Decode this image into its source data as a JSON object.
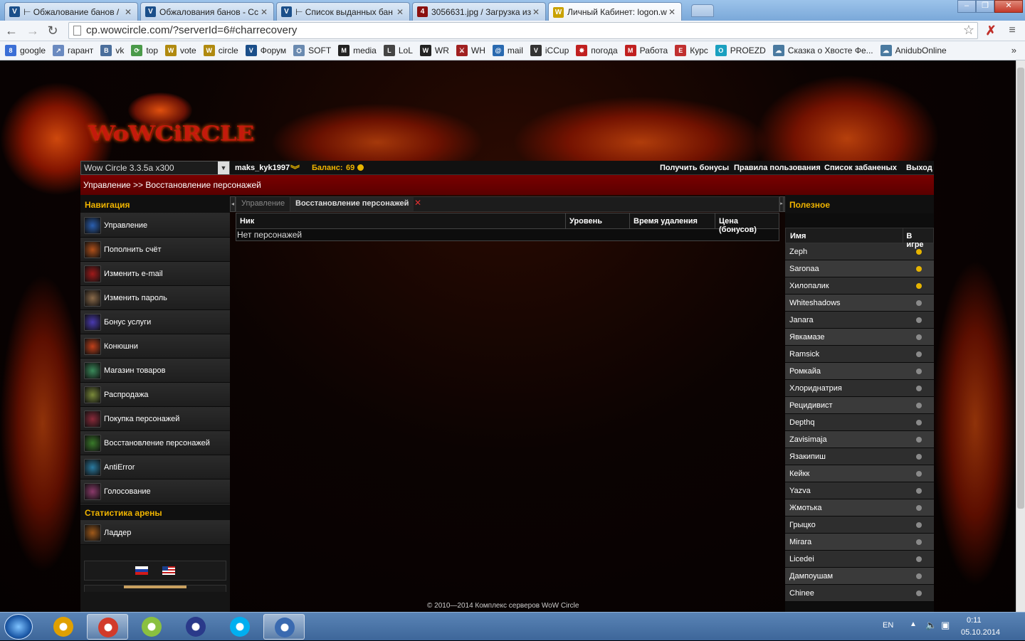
{
  "browser": {
    "tabs": [
      {
        "title": "⊢ Обжалование банов / ",
        "fav_color": "#1b4f8a",
        "fav_letter": "V",
        "active": false
      },
      {
        "title": "Обжалования банов - Cc",
        "fav_color": "#1b4f8a",
        "fav_letter": "V",
        "active": false
      },
      {
        "title": "⊢ Список выданных бан",
        "fav_color": "#1b4f8a",
        "fav_letter": "V",
        "active": false
      },
      {
        "title": "3056631.jpg / Загрузка из",
        "fav_color": "#8a1010",
        "fav_letter": "4",
        "active": false
      },
      {
        "title": "Личный Кабинет: logon.w",
        "fav_color": "#c9a200",
        "fav_letter": "W",
        "active": true
      }
    ],
    "window_buttons": {
      "min": "–",
      "max": "❐",
      "close": "✕"
    },
    "url": "cp.wowcircle.com/?serverId=6#charrecovery",
    "bookmarks": [
      {
        "label": "google",
        "color": "#3b6fd6",
        "glyph": "8"
      },
      {
        "label": "гарант",
        "color": "#6a8ac0",
        "glyph": "↗"
      },
      {
        "label": "vk",
        "color": "#4b6f9c",
        "glyph": "B"
      },
      {
        "label": "top",
        "color": "#4a9a4a",
        "glyph": "⟳"
      },
      {
        "label": "vote",
        "color": "#b08a10",
        "glyph": "W"
      },
      {
        "label": "circle",
        "color": "#b08a10",
        "glyph": "W"
      },
      {
        "label": "Форум",
        "color": "#1b4f8a",
        "glyph": "V"
      },
      {
        "label": "SOFT",
        "color": "#6a8ab0",
        "glyph": "⛭"
      },
      {
        "label": "media",
        "color": "#222",
        "glyph": "M"
      },
      {
        "label": "LoL",
        "color": "#444",
        "glyph": "L"
      },
      {
        "label": "WR",
        "color": "#222",
        "glyph": "W"
      },
      {
        "label": "WH",
        "color": "#a02020",
        "glyph": "⚔"
      },
      {
        "label": "mail",
        "color": "#2a6ab0",
        "glyph": "@"
      },
      {
        "label": "iCCup",
        "color": "#333",
        "glyph": "V"
      },
      {
        "label": "погода",
        "color": "#c02020",
        "glyph": "✸"
      },
      {
        "label": "Работа",
        "color": "#c02020",
        "glyph": "M"
      },
      {
        "label": "Курс",
        "color": "#c03030",
        "glyph": "E"
      },
      {
        "label": "PROEZD",
        "color": "#1aa0c0",
        "glyph": "O"
      },
      {
        "label": "Сказка о Хвосте Фе...",
        "color": "#4a7aa0",
        "glyph": "☁"
      },
      {
        "label": "AnidubOnline",
        "color": "#4a7aa0",
        "glyph": "☁"
      }
    ],
    "bookmarks_more": "»"
  },
  "site": {
    "logo_text": "WoWCiRCLE",
    "server": "Wow Circle 3.3.5a x300",
    "username": "maks_kyk1997",
    "balance_label": "Баланс:",
    "balance_value": "69",
    "top_links": [
      "Получить бонусы",
      "Правила пользования",
      "Список забаненых",
      "Выход"
    ],
    "breadcrumb": "Управление >> Восстановление персонажей",
    "nav_title": "Навигация",
    "nav_items": [
      {
        "label": "Управление",
        "color": "#2a5fb0"
      },
      {
        "label": "Пополнить счёт",
        "color": "#b0501a"
      },
      {
        "label": "Изменить e-mail",
        "color": "#a01a1a"
      },
      {
        "label": "Изменить пароль",
        "color": "#8a6a4a"
      },
      {
        "label": "Бонус услуги",
        "color": "#4a3ab0"
      },
      {
        "label": "Конюшни",
        "color": "#c0401a"
      },
      {
        "label": "Магазин товаров",
        "color": "#3a8a5a"
      },
      {
        "label": "Распродажа",
        "color": "#7a8a3a"
      },
      {
        "label": "Покупка персонажей",
        "color": "#8a2a3a"
      },
      {
        "label": "Восстановление персонажей",
        "color": "#3a7a2a"
      },
      {
        "label": "AntiError",
        "color": "#2a7aa0"
      },
      {
        "label": "Голосование",
        "color": "#8a3a6a"
      }
    ],
    "arena_title": "Статистика арены",
    "arena_items": [
      {
        "label": "Ладдер",
        "color": "#a05a1a"
      }
    ],
    "center_tabs": {
      "inactive": "Управление",
      "active": "Восстановление персонажей"
    },
    "grid": {
      "columns": [
        "Ник",
        "Уровень",
        "Время удаления",
        "Цена (бонусов)"
      ],
      "empty_text": "Нет персонажей"
    },
    "useful_title": "Полезное",
    "online_table": {
      "columns": [
        "Имя",
        "В игре"
      ],
      "rows": [
        {
          "name": "Zeph",
          "online": true
        },
        {
          "name": "Saronaa",
          "online": true
        },
        {
          "name": "Хилопалик",
          "online": true
        },
        {
          "name": "Whiteshadows",
          "online": false
        },
        {
          "name": "Janara",
          "online": false
        },
        {
          "name": "Явкамазе",
          "online": false
        },
        {
          "name": "Ramsick",
          "online": false
        },
        {
          "name": "Ромкайа",
          "online": false
        },
        {
          "name": "Хлориднатрия",
          "online": false
        },
        {
          "name": "Рецидивист",
          "online": false
        },
        {
          "name": "Depthq",
          "online": false
        },
        {
          "name": "Zavisimaja",
          "online": false
        },
        {
          "name": "Язакипиш",
          "online": false
        },
        {
          "name": "Кейкк",
          "online": false
        },
        {
          "name": "Yazva",
          "online": false
        },
        {
          "name": "Жмотька",
          "online": false
        },
        {
          "name": "Грыцко",
          "online": false
        },
        {
          "name": "Mirara",
          "online": false
        },
        {
          "name": "Licedei",
          "online": false
        },
        {
          "name": "Дампоушам",
          "online": false
        },
        {
          "name": "Chinee",
          "online": false
        }
      ]
    },
    "footer": "© 2010—2014 Комплекс серверов WoW Circle",
    "colors": {
      "accent": "#f0b400",
      "crumb": "#6a0000",
      "online": "#e6b400",
      "offline": "#8a8a8a"
    }
  },
  "taskbar": {
    "apps": [
      {
        "name": "app-aimp",
        "color": "#e0a000"
      },
      {
        "name": "app-chrome",
        "color": "#d23a2a"
      },
      {
        "name": "app-butterfly",
        "color": "#8ac040"
      },
      {
        "name": "app-floppy",
        "color": "#2a3a8a"
      },
      {
        "name": "app-skype",
        "color": "#00aff0"
      },
      {
        "name": "app-circle",
        "color": "#3a6ab0"
      }
    ],
    "lang": "EN",
    "time": "0:11",
    "date": "05.10.2014"
  }
}
